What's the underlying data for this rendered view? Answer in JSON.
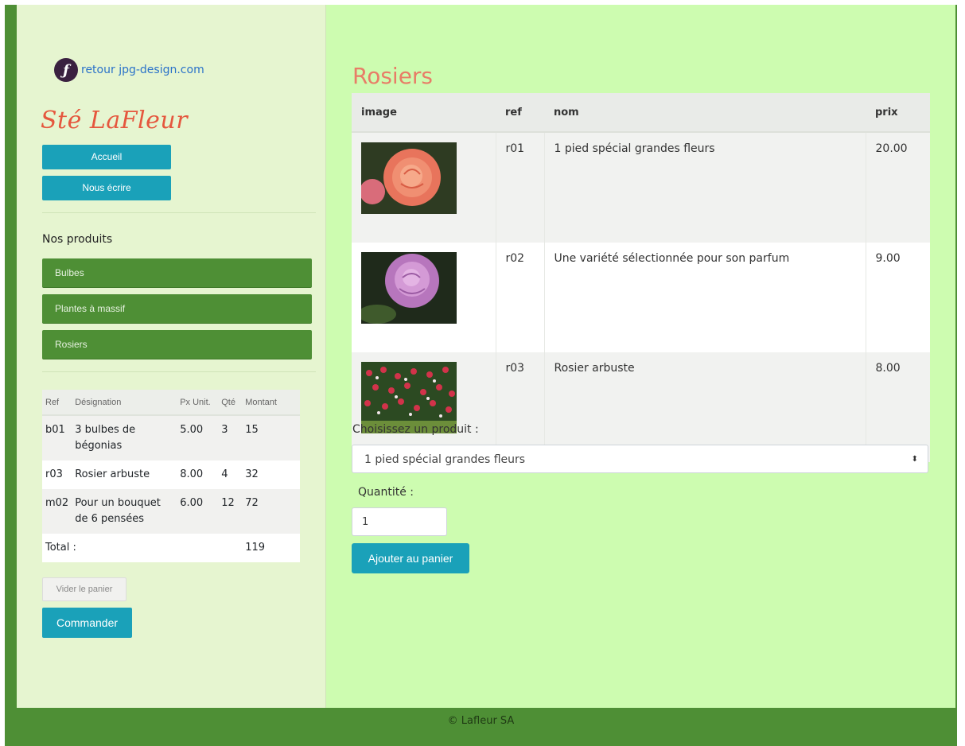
{
  "sidebar": {
    "back_link": "retour jpg-design.com",
    "logo_glyph": "ƒ",
    "brand": "Sté LaFleur",
    "nav": {
      "home": "Accueil",
      "contact": "Nous écrire"
    },
    "section_label": "Nos produits",
    "categories": [
      "Bulbes",
      "Plantes à massif",
      "Rosiers"
    ],
    "cart": {
      "headers": [
        "Ref",
        "Désignation",
        "Px Unit.",
        "Qté",
        "Montant"
      ],
      "rows": [
        {
          "ref": "b01",
          "designation": "3 bulbes de bégonias",
          "price": "5.00",
          "qty": "3",
          "amount": "15"
        },
        {
          "ref": "r03",
          "designation": "Rosier arbuste",
          "price": "8.00",
          "qty": "4",
          "amount": "32"
        },
        {
          "ref": "m02",
          "designation": "Pour un bouquet de 6 pensées",
          "price": "6.00",
          "qty": "12",
          "amount": "72"
        }
      ],
      "total_label": "Total :",
      "total_value": "119"
    },
    "empty_cart": "Vider le panier",
    "order": "Commander"
  },
  "main": {
    "title": "Rosiers",
    "table": {
      "headers": [
        "image",
        "ref",
        "nom",
        "prix"
      ],
      "rows": [
        {
          "ref": "r01",
          "name": "1 pied spécial grandes fleurs",
          "price": "20.00",
          "color": "#e8745c"
        },
        {
          "ref": "r02",
          "name": "Une variété sélectionnée pour son parfum",
          "price": "9.00",
          "color": "#c787c9"
        },
        {
          "ref": "r03",
          "name": "Rosier arbuste",
          "price": "8.00",
          "color": "#c53044"
        }
      ]
    },
    "choose_label": "Choisissez un produit :",
    "selected_product": "1 pied spécial grandes fleurs",
    "select_caret": "⬍",
    "qty_label": "Quantité :",
    "qty_value": "1",
    "add_button": "Ajouter au panier"
  },
  "footer": {
    "text": "© Lafleur SA"
  }
}
